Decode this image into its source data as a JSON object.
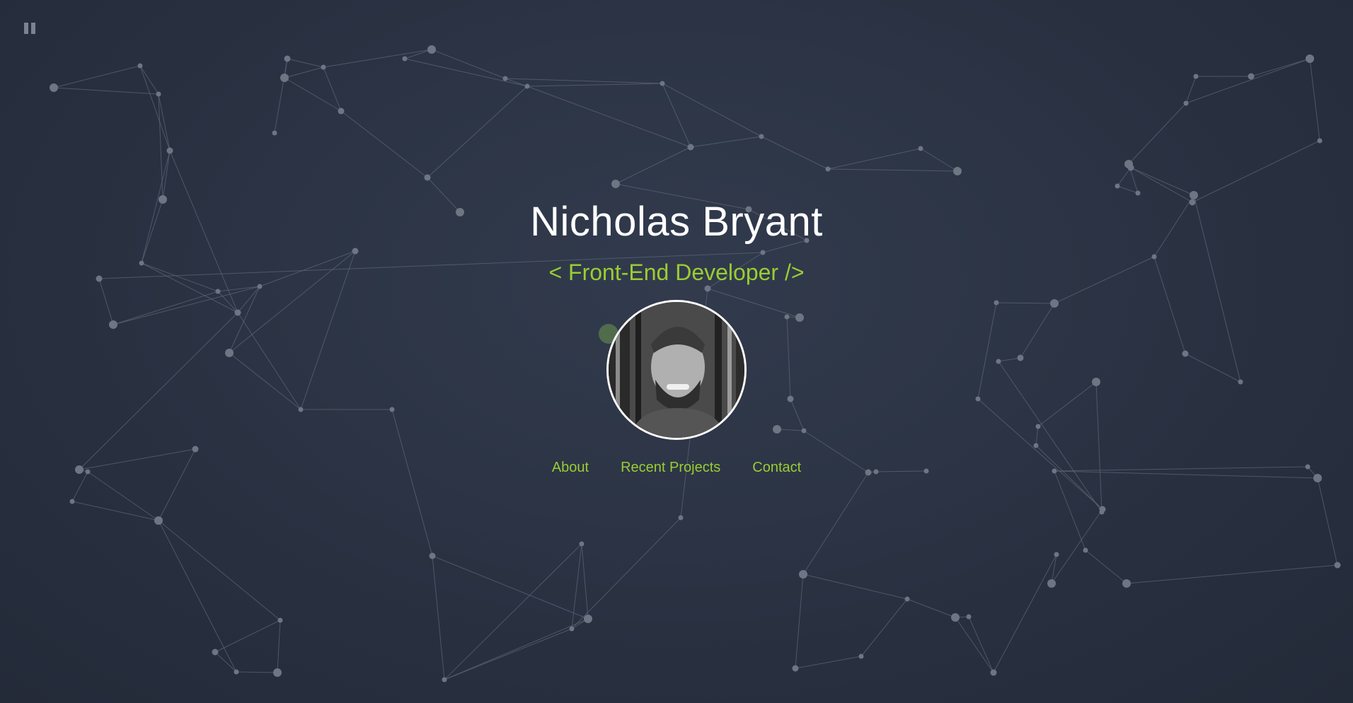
{
  "controls": {
    "pause_icon": "pause-icon"
  },
  "hero": {
    "name": "Nicholas Bryant",
    "tagline": "< Front-End Developer />",
    "avatar_alt": "Nicholas Bryant"
  },
  "nav": {
    "items": [
      {
        "label": "About"
      },
      {
        "label": "Recent Projects"
      },
      {
        "label": "Contact"
      }
    ]
  },
  "colors": {
    "background": "#2b3344",
    "accent": "#9acd32",
    "name_text": "#ffffff",
    "network_line": "#5c6575",
    "network_node": "#6e7583"
  }
}
